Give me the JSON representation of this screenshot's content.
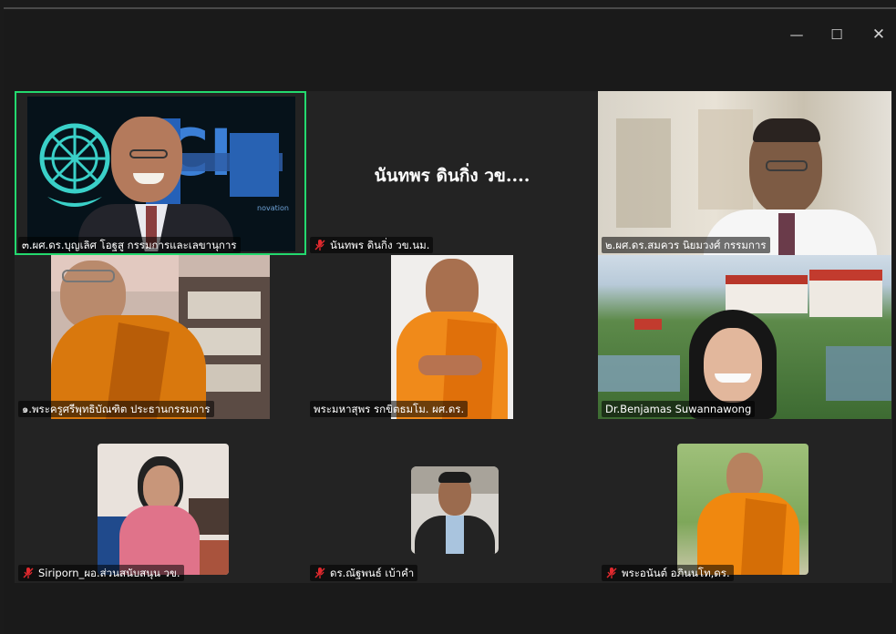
{
  "window": {
    "minimize_glyph": "—",
    "maximize_glyph": "☐",
    "close_glyph": "✕"
  },
  "tiles": [
    {
      "name": "๓.ผศ.ดร.บุญเลิศ โอฐสู กรรมการและเลขานุการ",
      "muted": false,
      "active": true,
      "kind": "video",
      "background_text": "ICI",
      "background_subtext": "novation"
    },
    {
      "name": "นันทพร ดินกิ่ง วข.นม.",
      "center_label": "นันทพร ดินกิ่ง วข....",
      "muted": true,
      "kind": "name-only"
    },
    {
      "name": "๒.ผศ.ดร.สมควร นิยมวงศ์ กรรมการ",
      "muted": false,
      "kind": "video"
    },
    {
      "name": "๑.พระครูศรีพุทธิบัณฑิต ประธานกรรมการ",
      "muted": false,
      "kind": "video"
    },
    {
      "name": "พระมหาสุพร รกขิตธมโม. ผศ.ดร.",
      "muted": false,
      "kind": "photo"
    },
    {
      "name": "Dr.Benjamas Suwannawong",
      "muted": false,
      "kind": "video"
    },
    {
      "name": "Siriporn_ผอ.ส่วนสนับสนุน วข.",
      "muted": true,
      "kind": "photo"
    },
    {
      "name": "ดร.ณัฐพนธ์ เบ้าคำ",
      "muted": true,
      "kind": "photo"
    },
    {
      "name": "พระอนันต์ อภินนโท,ดร.",
      "muted": true,
      "kind": "photo"
    }
  ],
  "icons": {
    "mute": "microphone-muted-icon",
    "accent_active": "#23d96e",
    "mute_color": "#e0292e"
  }
}
